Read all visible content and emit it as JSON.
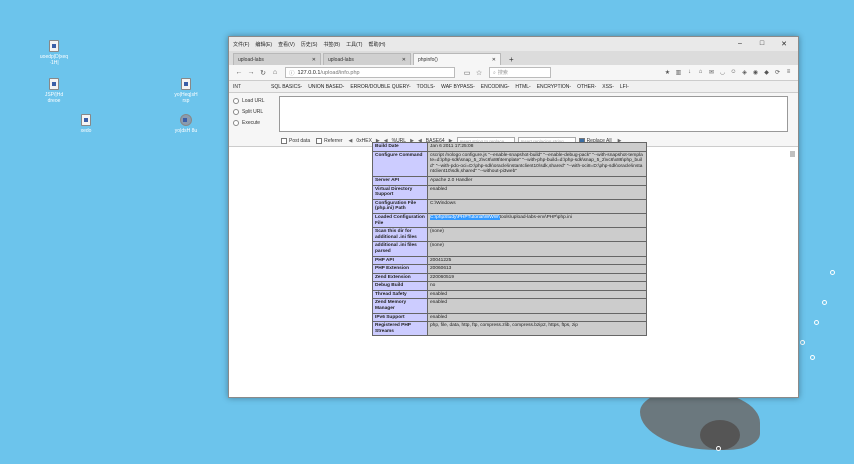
{
  "desktop": {
    "icons": [
      {
        "label": "uoedp|D|xeq\n·1H|",
        "icon": "file-icon"
      },
      {
        "label": "JSP/|Hd\ndreoe",
        "icon": "file-icon"
      },
      {
        "label": "xedo",
        "icon": "file-icon"
      },
      {
        "label": "yo|Heq|sH\nrsp",
        "icon": "doc-icon"
      },
      {
        "label": "yo|dsH 8u",
        "icon": "app-icon"
      }
    ]
  },
  "browser": {
    "menu": [
      "文件(F)",
      "编辑(E)",
      "查看(V)",
      "历史(S)",
      "书签(B)",
      "工具(T)",
      "帮助(H)"
    ],
    "tabs": [
      {
        "label": "upload-labs",
        "active": false
      },
      {
        "label": "upload-labs",
        "active": false
      },
      {
        "label": "phpinfo()",
        "active": true
      }
    ],
    "url_host": "127.0.0.1",
    "url_path": "/upload/info.php",
    "search_placeholder": "搜索"
  },
  "hackbar": {
    "select": "INT",
    "menu": [
      "SQL BASICS-",
      "UNION BASED-",
      "ERROR/DOUBLE QUERY-",
      "TOOLS-",
      "WAF BYPASS-",
      "ENCODING-",
      "HTML-",
      "ENCRYPTION-",
      "OTHER-",
      "XSS-",
      "LFI-"
    ],
    "actions": [
      "Load URL",
      "Split URL",
      "Execute"
    ],
    "options": {
      "post_data": "Post data",
      "referrer": "Referrer",
      "hex": "0xHEX",
      "url": "%URL",
      "base64": "BASE64",
      "replace_placeholder": "Insert string to replace",
      "replacing_placeholder": "Insert replacing string",
      "replace_all": "Replace All"
    }
  },
  "phpinfo": {
    "rows": [
      {
        "key": "Build Date",
        "value": "Jan 6 2011 17:25:08"
      },
      {
        "key": "Configure Command",
        "value": "cscript /nologo configure.js \"--enable-snapshot-build\" \"--enable-debug-pack\" \"--with-snapshot-template=d:\\php-sdk\\snap_5_2\\vc6\\x86\\template\" \"--with-php-build=d:\\php-sdk\\snap_5_2\\vc6\\x86\\php_build\" \"--with-pdo-oci=D:\\php-sdk\\oracle\\instantclient10\\sdk,shared\" \"--with-oci8=D:\\php-sdk\\oracle\\instantclient10\\sdk,shared\" \"--without-pi3web\""
      },
      {
        "key": "Server API",
        "value": "Apache 2.0 Handler"
      },
      {
        "key": "Virtual Directory Support",
        "value": "enabled"
      },
      {
        "key": "Configuration File (php.ini) Path",
        "value": "C:\\Windows"
      },
      {
        "key": "Loaded Configuration File",
        "value_hl": "C:\\phpStudy\\PHPTutorial\\WWW\\",
        "value": "tools\\upload-labs-env\\PHP\\php.ini"
      },
      {
        "key": "Scan this dir for additional .ini files",
        "value": "(none)"
      },
      {
        "key": "additional .ini files parsed",
        "value": "(none)"
      },
      {
        "key": "PHP API",
        "value": "20041225"
      },
      {
        "key": "PHP Extension",
        "value": "20060613"
      },
      {
        "key": "Zend Extension",
        "value": "220060519"
      },
      {
        "key": "Debug Build",
        "value": "no"
      },
      {
        "key": "Thread Safety",
        "value": "enabled"
      },
      {
        "key": "Zend Memory Manager",
        "value": "enabled"
      },
      {
        "key": "IPv6 Support",
        "value": "enabled"
      },
      {
        "key": "Registered PHP Streams",
        "value": "php, file, data, http, ftp, compress.zlib, compress.bzip2, https, ftps, zip"
      }
    ]
  }
}
